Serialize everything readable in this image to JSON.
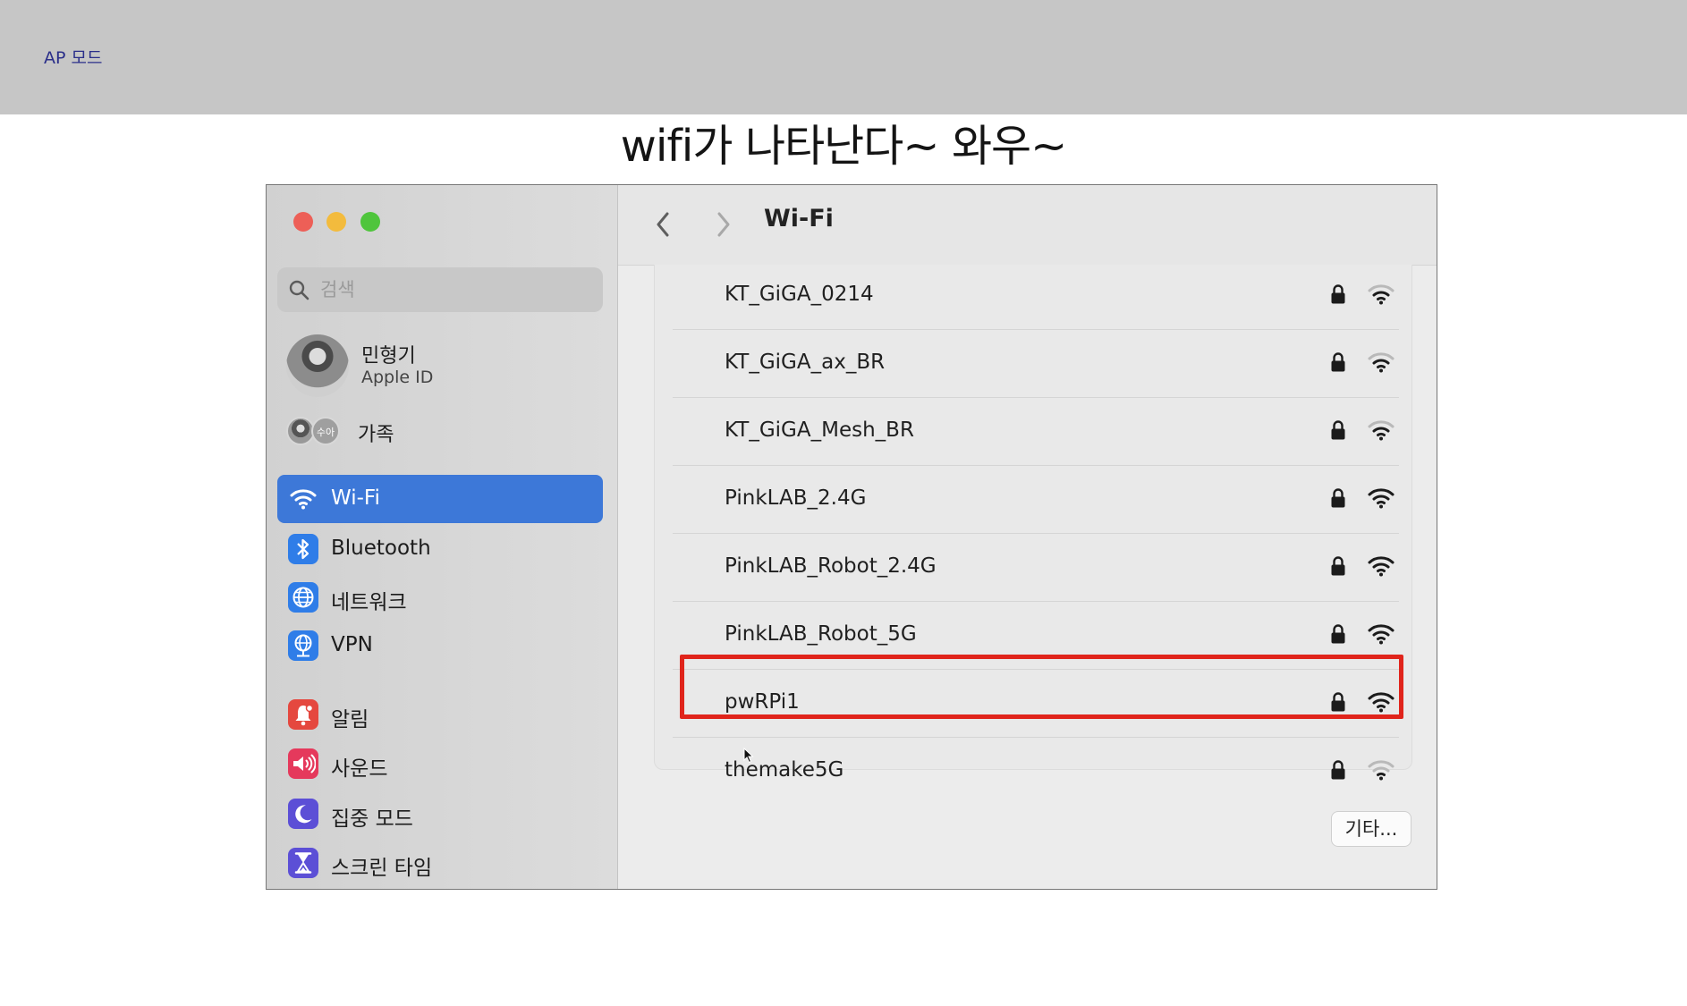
{
  "slide": {
    "top_label": "AP 모드",
    "caption": "wifi가 나타난다~ 와우~"
  },
  "window": {
    "toolbar": {
      "back_icon": "chevron-left-icon",
      "forward_icon": "chevron-right-icon",
      "title": "Wi-Fi"
    },
    "sidebar": {
      "search": {
        "placeholder": "검색",
        "value": ""
      },
      "profile": {
        "name": "민형기",
        "subtitle": "Apple ID"
      },
      "family": {
        "label": "가족",
        "badge": "수아"
      },
      "items": [
        {
          "label": "Wi-Fi",
          "icon": "wifi-icon",
          "color": "#3d78d8",
          "selected": true
        },
        {
          "label": "Bluetooth",
          "icon": "bluetooth-icon",
          "color": "#2f7de8"
        },
        {
          "label": "네트워크",
          "icon": "globe-icon",
          "color": "#2f7de8"
        },
        {
          "label": "VPN",
          "icon": "vpn-globe-icon",
          "color": "#2f7de8"
        },
        {
          "label": "알림",
          "icon": "bell-icon",
          "color": "#e5483f"
        },
        {
          "label": "사운드",
          "icon": "speaker-icon",
          "color": "#e5395c"
        },
        {
          "label": "집중 모드",
          "icon": "moon-icon",
          "color": "#5c4fd6"
        },
        {
          "label": "스크린 타임",
          "icon": "hourglass-icon",
          "color": "#5c4fd6"
        }
      ]
    },
    "networks": [
      {
        "name": "KT_GiGA_0214",
        "locked": true,
        "signal": "weak"
      },
      {
        "name": "KT_GiGA_ax_BR",
        "locked": true,
        "signal": "weak"
      },
      {
        "name": "KT_GiGA_Mesh_BR",
        "locked": true,
        "signal": "weak"
      },
      {
        "name": "PinkLAB_2.4G",
        "locked": true,
        "signal": "strong"
      },
      {
        "name": "PinkLAB_Robot_2.4G",
        "locked": true,
        "signal": "strong"
      },
      {
        "name": "PinkLAB_Robot_5G",
        "locked": true,
        "signal": "strong"
      },
      {
        "name": "pwRPi1",
        "locked": true,
        "signal": "strong",
        "highlighted": true
      },
      {
        "name": "themake5G",
        "locked": true,
        "signal": "weak"
      }
    ],
    "other_button": "기타...",
    "highlight_color": "#e0241b"
  }
}
